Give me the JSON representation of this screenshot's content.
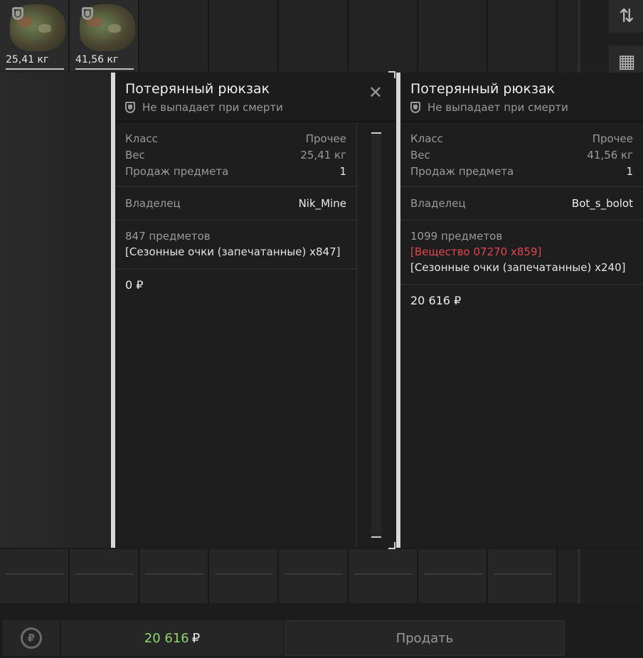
{
  "inventory_top": {
    "slots": [
      {
        "weight": "25,41 кг",
        "icon": "backpack-icon"
      },
      {
        "weight": "41,56 кг",
        "icon": "backpack-icon"
      }
    ]
  },
  "panel_left": {
    "title": "Потерянный рюкзак",
    "subtitle": "Не выпадает при смерти",
    "class_label": "Класс",
    "class_value": "Прочее",
    "weight_label": "Вес",
    "weight_value": "25,41 кг",
    "sale_label": "Продаж предмета",
    "sale_value": "1",
    "owner_label": "Владелец",
    "owner_value": "Nik_Mine",
    "items_count": "847 предметов",
    "items": [
      "[Сезонные очки (запечатанные) x847]"
    ],
    "money": "0 ₽"
  },
  "panel_right": {
    "title": "Потерянный рюкзак",
    "subtitle": "Не выпадает при смерти",
    "class_label": "Класс",
    "class_value": "Прочее",
    "weight_label": "Вес",
    "weight_value": "41,56 кг",
    "sale_label": "Продаж предмета",
    "sale_value": "1",
    "owner_label": "Владелец",
    "owner_value": "Bot_s_bolot",
    "items_count": "1099 предметов",
    "items_red": "[Вещество 07270 x859]",
    "items": [
      "[Сезонные очки (запечатанные) x240]"
    ],
    "money": "20 616 ₽"
  },
  "footer": {
    "total_value": "20 616",
    "currency": "₽",
    "sell_label": "Продать"
  },
  "colors": {
    "accent_green": "#8fd46d",
    "warning_red": "#e2464f"
  }
}
